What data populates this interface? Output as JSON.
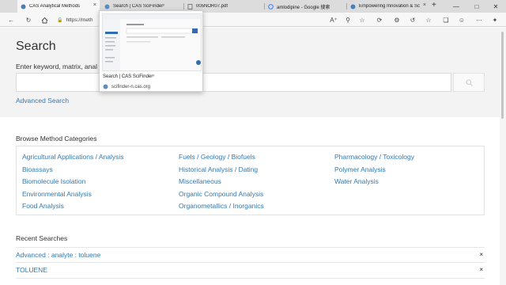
{
  "browser": {
    "tabs": [
      {
        "label": "CAS Analytical Methods",
        "icon": "cas-icon",
        "active": true
      },
      {
        "label": "Search | CAS SciFinderⁿ",
        "icon": "scifinder-icon",
        "active": false
      },
      {
        "label": "005NOR07.pdf",
        "icon": "pdf-icon",
        "active": false
      },
      {
        "label": "amlodipine - Google 搜索",
        "icon": "google-icon",
        "active": false
      },
      {
        "label": "Empowering Innovation & Sc",
        "icon": "cas-icon",
        "active": false
      }
    ],
    "close_glyph": "×",
    "new_tab_glyph": "+",
    "address_url": "https://meth",
    "hover_card": {
      "title": "Search | CAS SciFinderⁿ",
      "url": "scifinder-n.cas.org"
    }
  },
  "page": {
    "title": "Search",
    "search_label": "Enter keyword, matrix, anal",
    "search_value": "",
    "search_button_icon": "search-icon",
    "advanced_search": "Advanced Search",
    "categories_heading": "Browse Method Categories",
    "categories": [
      [
        "Agricultural Applications / Analysis",
        "Bioassays",
        "Biomolecule Isolation",
        "Environmental Analysis",
        "Food Analysis"
      ],
      [
        "Fuels / Geology / Biofuels",
        "Historical Analysis / Dating",
        "Miscellaneous",
        "Organic Compound Analysis",
        "Organometallics / Inorganics"
      ],
      [
        "Pharmacology / Toxicology",
        "Polymer Analysis",
        "Water Analysis"
      ]
    ],
    "recent_heading": "Recent Searches",
    "recent_searches": [
      {
        "label": "Advanced : analyte : toluene",
        "remove": "×"
      },
      {
        "label": "TOLUENE",
        "remove": "×"
      }
    ]
  },
  "colors": {
    "link": "#3279b3",
    "page_bg": "#f3f3f3",
    "text": "#333333"
  }
}
